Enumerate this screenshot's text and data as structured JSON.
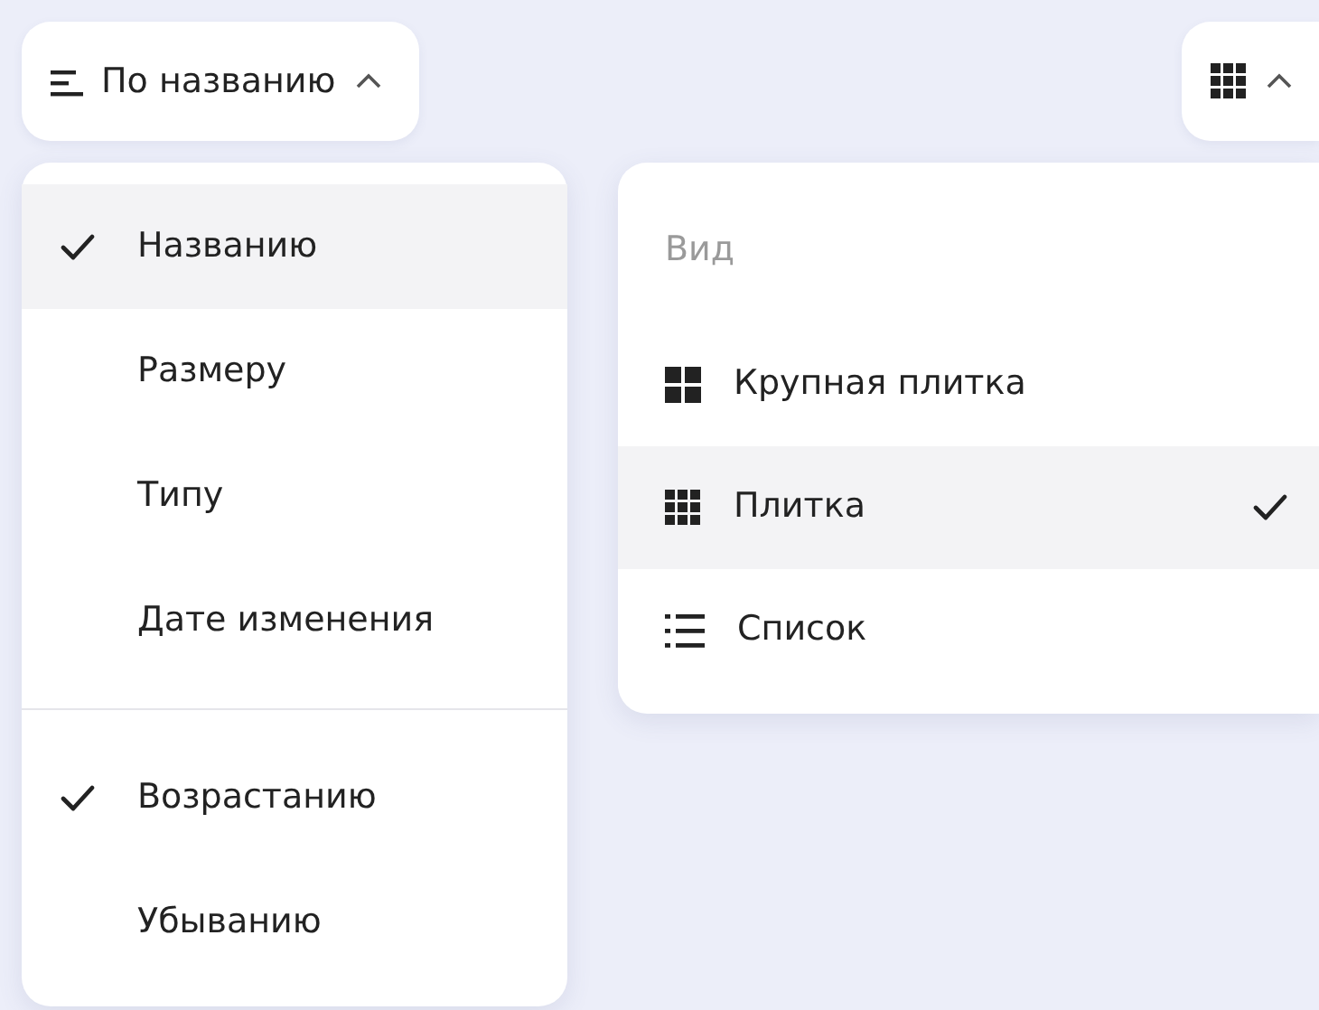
{
  "sort_button": {
    "label": "По названию",
    "expanded": true
  },
  "sort_menu": {
    "groups": [
      {
        "items": [
          {
            "label": "Названию",
            "selected": true
          },
          {
            "label": "Размеру",
            "selected": false
          },
          {
            "label": "Типу",
            "selected": false
          },
          {
            "label": "Дате изменения",
            "selected": false
          }
        ]
      },
      {
        "items": [
          {
            "label": "Возрастанию",
            "selected": true
          },
          {
            "label": "Убыванию",
            "selected": false
          }
        ]
      }
    ]
  },
  "view_button": {
    "expanded": true
  },
  "view_menu": {
    "header": "Вид",
    "items": [
      {
        "label": "Крупная плитка",
        "kind": "large-tiles",
        "selected": false
      },
      {
        "label": "Плитка",
        "kind": "tiles",
        "selected": true
      },
      {
        "label": "Список",
        "kind": "list",
        "selected": false
      }
    ]
  }
}
